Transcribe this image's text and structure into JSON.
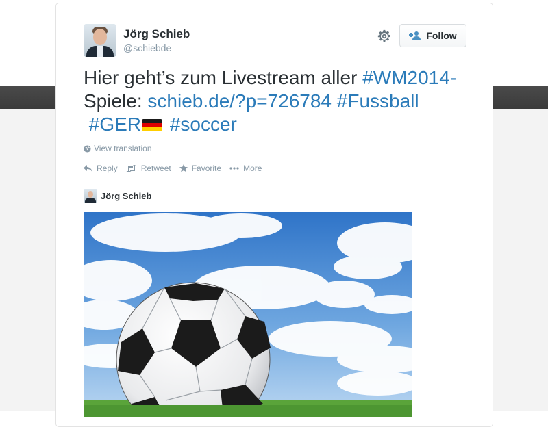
{
  "tweet": {
    "author_name": "Jörg Schieb",
    "author_handle": "@schiebde",
    "follow_label": "Follow",
    "text": {
      "line1_plain": "Hier geht’s zum Livestream aller ",
      "hashtag_wm": "#WM2014-",
      "line2_plain": "Spiele: ",
      "link": "schieb.de/?p=726784",
      "hashtag_fussball": "#Fussball",
      "hashtag_ger": "#GER",
      "hashtag_soccer": "#soccer"
    },
    "view_translation": "View translation",
    "actions": {
      "reply": "Reply",
      "retweet": "Retweet",
      "favorite": "Favorite",
      "more": "More"
    },
    "card": {
      "author_name": "Jörg Schieb"
    }
  },
  "icons": {
    "settings": "gear-icon",
    "follow": "add-user-icon",
    "globe": "globe-icon",
    "reply": "reply-icon",
    "retweet": "retweet-icon",
    "favorite": "star-icon",
    "more": "ellipsis-icon",
    "flag": "germany-flag-icon"
  },
  "colors": {
    "link": "#2b7bb9",
    "text": "#292f33",
    "muted": "#8899a6"
  }
}
